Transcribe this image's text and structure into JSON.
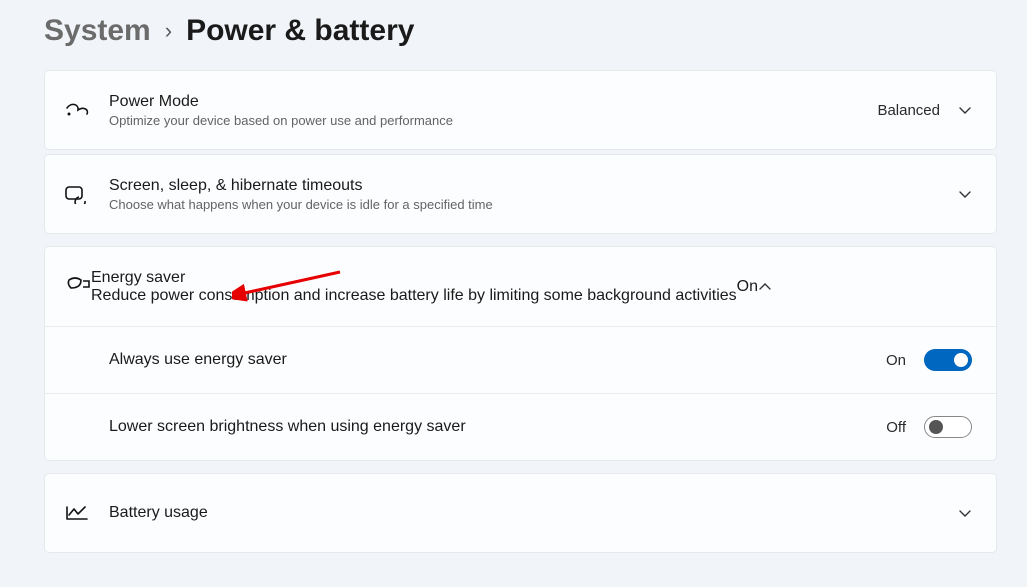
{
  "breadcrumb": {
    "parent": "System",
    "current": "Power & battery"
  },
  "powerMode": {
    "title": "Power Mode",
    "subtitle": "Optimize your device based on power use and performance",
    "value": "Balanced"
  },
  "screenSleep": {
    "title": "Screen, sleep, & hibernate timeouts",
    "subtitle": "Choose what happens when your device is idle for a specified time"
  },
  "energySaver": {
    "title": "Energy saver",
    "subtitle": "Reduce power consumption and increase battery life by limiting some background activities",
    "value": "On",
    "always": {
      "label": "Always use energy saver",
      "state": "On"
    },
    "brightness": {
      "label": "Lower screen brightness when using energy saver",
      "state": "Off"
    }
  },
  "batteryUsage": {
    "title": "Battery usage"
  }
}
